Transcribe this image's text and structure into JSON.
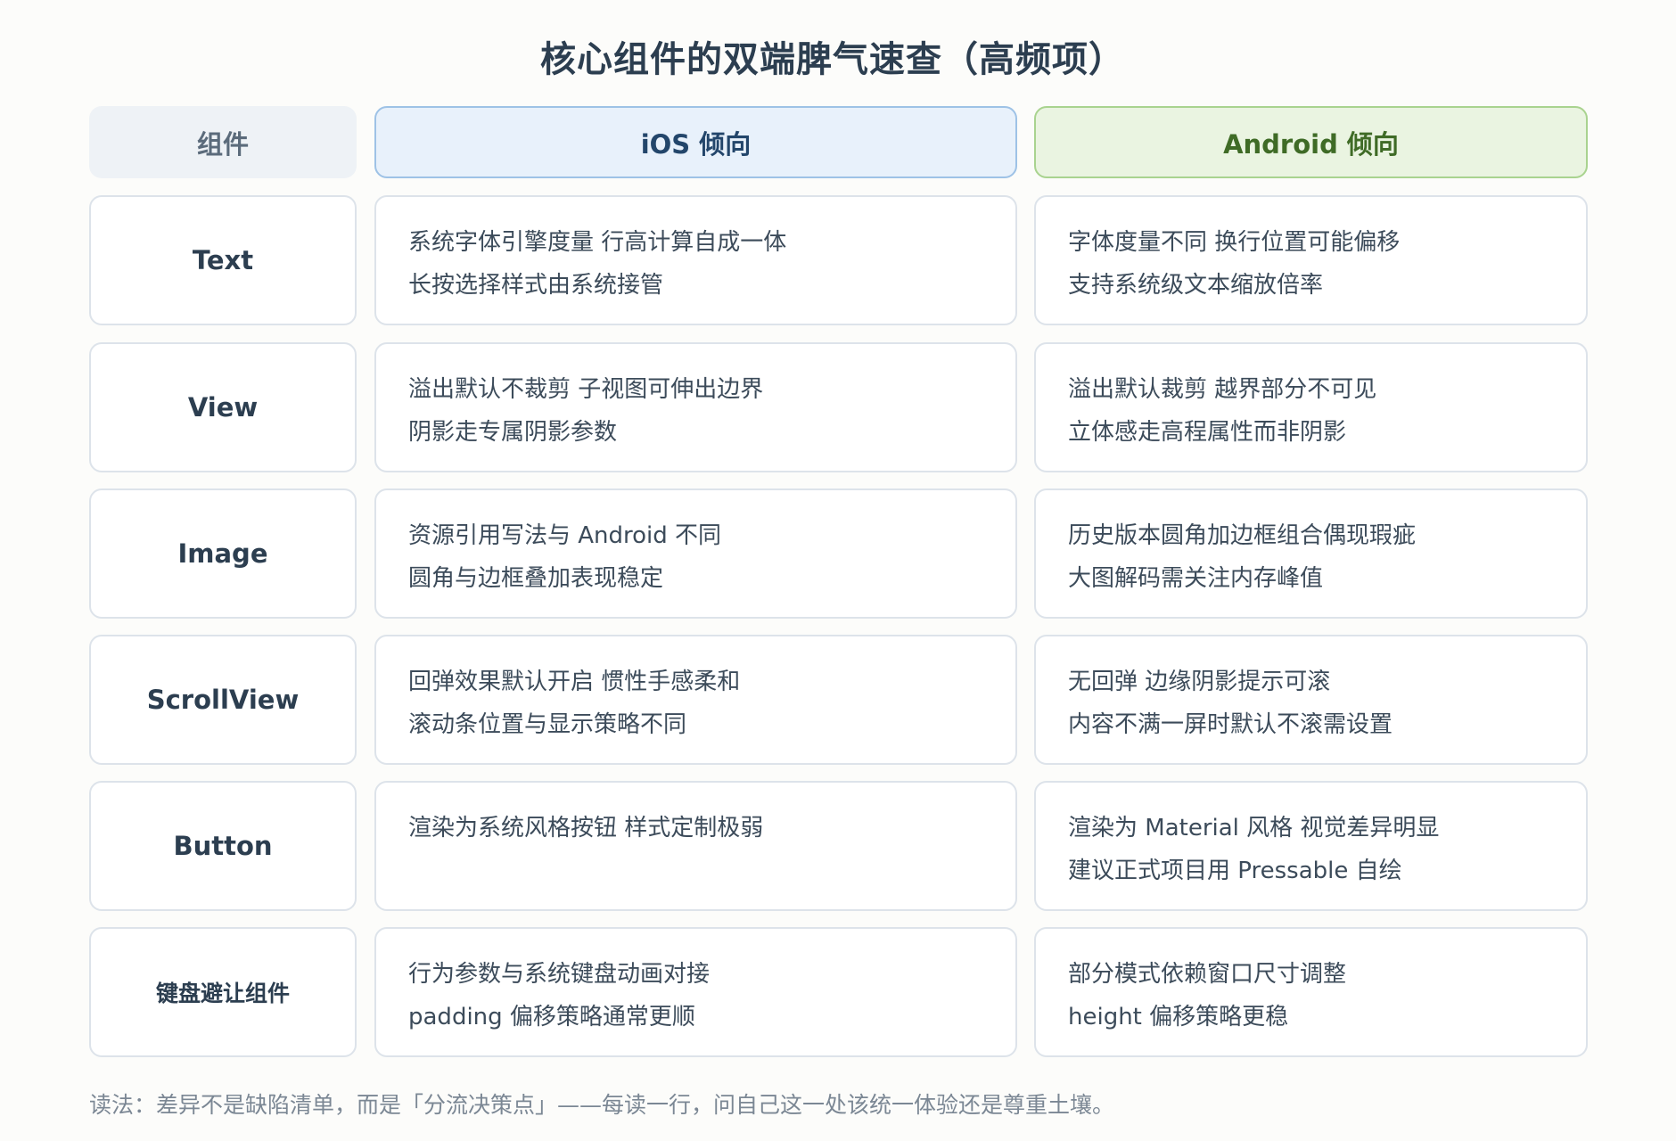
{
  "title": "核心组件的双端脾气速查（高频项）",
  "headers": {
    "component": "组件",
    "ios": "iOS 倾向",
    "android": "Android 倾向"
  },
  "rows": [
    {
      "name": "Text",
      "ios": [
        "系统字体引擎度量 行高计算自成一体",
        "长按选择样式由系统接管"
      ],
      "android": [
        "字体度量不同 换行位置可能偏移",
        "支持系统级文本缩放倍率"
      ]
    },
    {
      "name": "View",
      "ios": [
        "溢出默认不裁剪 子视图可伸出边界",
        "阴影走专属阴影参数"
      ],
      "android": [
        "溢出默认裁剪 越界部分不可见",
        "立体感走高程属性而非阴影"
      ]
    },
    {
      "name": "Image",
      "ios": [
        "资源引用写法与 Android 不同",
        "圆角与边框叠加表现稳定"
      ],
      "android": [
        "历史版本圆角加边框组合偶现瑕疵",
        "大图解码需关注内存峰值"
      ]
    },
    {
      "name": "ScrollView",
      "ios": [
        "回弹效果默认开启 惯性手感柔和",
        "滚动条位置与显示策略不同"
      ],
      "android": [
        "无回弹 边缘阴影提示可滚",
        "内容不满一屏时默认不滚需设置"
      ]
    },
    {
      "name": "Button",
      "ios": [
        "渲染为系统风格按钮 样式定制极弱",
        ""
      ],
      "android": [
        "渲染为 Material 风格 视觉差异明显",
        "建议正式项目用 Pressable 自绘"
      ]
    },
    {
      "name": "键盘避让组件",
      "ios": [
        "行为参数与系统键盘动画对接",
        "padding 偏移策略通常更顺"
      ],
      "android": [
        "部分模式依赖窗口尺寸调整",
        "height 偏移策略更稳"
      ]
    }
  ],
  "footer": "读法：差异不是缺陷清单，而是「分流决策点」——每读一行，问自己这一处该统一体验还是尊重土壤。"
}
